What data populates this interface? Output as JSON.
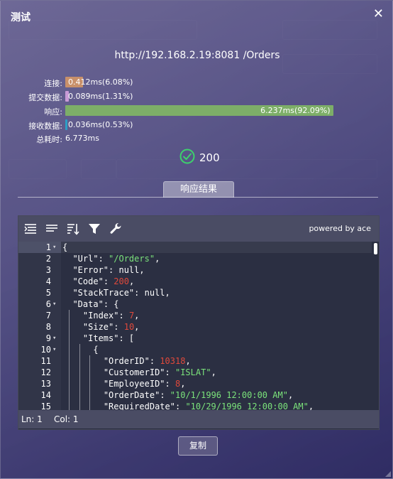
{
  "modal": {
    "title": "测试",
    "close_symbol": "✕",
    "request_line": "http://192.168.2.19:8081 /Orders"
  },
  "timings": [
    {
      "label": "连接:",
      "value": "0.412ms(6.08%)",
      "percent": 6.08,
      "color": "#c8906a"
    },
    {
      "label": "提交数据:",
      "value": "0.089ms(1.31%)",
      "percent": 1.31,
      "color": "#c89ad6"
    },
    {
      "label": "响应:",
      "value": "6.237ms(92.09%)",
      "percent": 92.09,
      "color": "#7dae68"
    },
    {
      "label": "接收数据:",
      "value": "0.036ms(0.53%)",
      "percent": 0.53,
      "color": "#2d9fc6"
    }
  ],
  "total": {
    "label": "总耗时:",
    "value": "6.773ms"
  },
  "status": {
    "code": "200",
    "icon": "check-circle-icon",
    "color": "#3dd26c"
  },
  "tab": {
    "label": "响应结果"
  },
  "editor": {
    "powered_by": "powered by ace",
    "toolbar_icons": [
      "format-icon",
      "compact-icon",
      "sort-icon",
      "filter-icon",
      "wrench-icon"
    ],
    "lines": [
      {
        "num": "1",
        "fold": true,
        "indent": 0,
        "tokens": [
          {
            "t": "{",
            "c": "p"
          }
        ]
      },
      {
        "num": "2",
        "fold": false,
        "indent": 1,
        "tokens": [
          {
            "t": "\"Url\"",
            "c": "k"
          },
          {
            "t": ": ",
            "c": "p"
          },
          {
            "t": "\"/Orders\"",
            "c": "s"
          },
          {
            "t": ",",
            "c": "p"
          }
        ]
      },
      {
        "num": "3",
        "fold": false,
        "indent": 1,
        "tokens": [
          {
            "t": "\"Error\"",
            "c": "k"
          },
          {
            "t": ": null,",
            "c": "p"
          }
        ]
      },
      {
        "num": "4",
        "fold": false,
        "indent": 1,
        "tokens": [
          {
            "t": "\"Code\"",
            "c": "k"
          },
          {
            "t": ": ",
            "c": "p"
          },
          {
            "t": "200",
            "c": "n"
          },
          {
            "t": ",",
            "c": "p"
          }
        ]
      },
      {
        "num": "5",
        "fold": false,
        "indent": 1,
        "tokens": [
          {
            "t": "\"StackTrace\"",
            "c": "k"
          },
          {
            "t": ": null,",
            "c": "p"
          }
        ]
      },
      {
        "num": "6",
        "fold": true,
        "indent": 1,
        "tokens": [
          {
            "t": "\"Data\"",
            "c": "k"
          },
          {
            "t": ": {",
            "c": "p"
          }
        ]
      },
      {
        "num": "7",
        "fold": false,
        "indent": 2,
        "tokens": [
          {
            "t": "\"Index\"",
            "c": "k"
          },
          {
            "t": ": ",
            "c": "p"
          },
          {
            "t": "7",
            "c": "n"
          },
          {
            "t": ",",
            "c": "p"
          }
        ]
      },
      {
        "num": "8",
        "fold": false,
        "indent": 2,
        "tokens": [
          {
            "t": "\"Size\"",
            "c": "k"
          },
          {
            "t": ": ",
            "c": "p"
          },
          {
            "t": "10",
            "c": "n"
          },
          {
            "t": ",",
            "c": "p"
          }
        ]
      },
      {
        "num": "9",
        "fold": true,
        "indent": 2,
        "tokens": [
          {
            "t": "\"Items\"",
            "c": "k"
          },
          {
            "t": ": [",
            "c": "p"
          }
        ]
      },
      {
        "num": "10",
        "fold": true,
        "indent": 3,
        "tokens": [
          {
            "t": "{",
            "c": "p"
          }
        ]
      },
      {
        "num": "11",
        "fold": false,
        "indent": 4,
        "tokens": [
          {
            "t": "\"OrderID\"",
            "c": "k"
          },
          {
            "t": ": ",
            "c": "p"
          },
          {
            "t": "10318",
            "c": "n"
          },
          {
            "t": ",",
            "c": "p"
          }
        ]
      },
      {
        "num": "12",
        "fold": false,
        "indent": 4,
        "tokens": [
          {
            "t": "\"CustomerID\"",
            "c": "k"
          },
          {
            "t": ": ",
            "c": "p"
          },
          {
            "t": "\"ISLAT\"",
            "c": "s"
          },
          {
            "t": ",",
            "c": "p"
          }
        ]
      },
      {
        "num": "13",
        "fold": false,
        "indent": 4,
        "tokens": [
          {
            "t": "\"EmployeeID\"",
            "c": "k"
          },
          {
            "t": ": ",
            "c": "p"
          },
          {
            "t": "8",
            "c": "n"
          },
          {
            "t": ",",
            "c": "p"
          }
        ]
      },
      {
        "num": "14",
        "fold": false,
        "indent": 4,
        "tokens": [
          {
            "t": "\"OrderDate\"",
            "c": "k"
          },
          {
            "t": ": ",
            "c": "p"
          },
          {
            "t": "\"10/1/1996 12:00:00 AM\"",
            "c": "s"
          },
          {
            "t": ",",
            "c": "p"
          }
        ]
      },
      {
        "num": "15",
        "fold": false,
        "indent": 4,
        "tokens": [
          {
            "t": "\"RequiredDate\"",
            "c": "k"
          },
          {
            "t": ": ",
            "c": "p"
          },
          {
            "t": "\"10/29/1996 12:00:00 AM\"",
            "c": "s"
          },
          {
            "t": ",",
            "c": "p"
          }
        ]
      }
    ],
    "status": {
      "ln": "Ln: 1",
      "col": "Col: 1"
    }
  },
  "copy_button": "复制"
}
